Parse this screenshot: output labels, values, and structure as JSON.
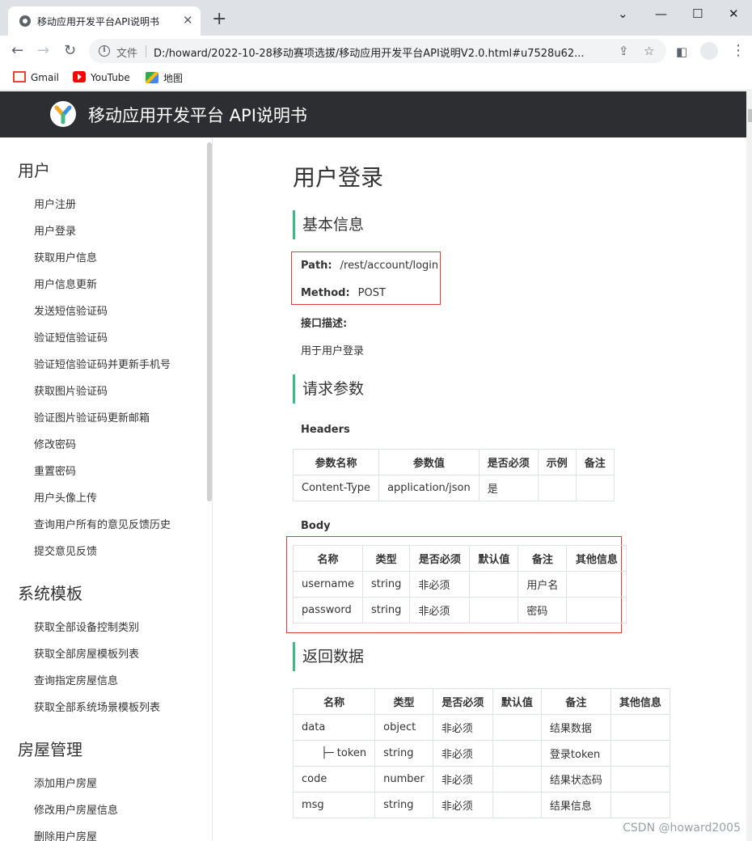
{
  "browser": {
    "tab_title": "移动应用开发平台API说明书",
    "tab_close": "✕",
    "new_tab": "+",
    "window_controls": {
      "minimize": "⌄",
      "restore": "—",
      "maximize": "☐",
      "close": "✕"
    },
    "nav": {
      "back": "←",
      "forward": "→",
      "reload": "↻"
    },
    "omnibox": {
      "label": "文件",
      "url": "D:/howard/2022-10-28移动赛项选拔/移动应用开发平台API说明V2.0.html#u7528u62..."
    },
    "bookmarks": [
      {
        "label": "Gmail",
        "icon": "gmail-icon"
      },
      {
        "label": "YouTube",
        "icon": "youtube-icon"
      },
      {
        "label": "地图",
        "icon": "maps-icon"
      }
    ]
  },
  "site": {
    "title": "移动应用开发平台 API说明书"
  },
  "sidebar": {
    "groups": [
      {
        "title": "用户",
        "items": [
          "用户注册",
          "用户登录",
          "获取用户信息",
          "用户信息更新",
          "发送短信验证码",
          "验证短信验证码",
          "验证短信验证码并更新手机号",
          "获取图片验证码",
          "验证图片验证码更新邮箱",
          "修改密码",
          "重置密码",
          "用户头像上传",
          "查询用户所有的意见反馈历史",
          "提交意见反馈"
        ]
      },
      {
        "title": "系统模板",
        "items": [
          "获取全部设备控制类别",
          "获取全部房屋模板列表",
          "查询指定房屋信息",
          "获取全部系统场景模板列表"
        ]
      },
      {
        "title": "房屋管理",
        "items": [
          "添加用户房屋",
          "修改用户房屋信息",
          "删除用户房屋"
        ]
      }
    ]
  },
  "main": {
    "title": "用户登录",
    "basic": {
      "heading": "基本信息",
      "path_label": "Path:",
      "path": "/rest/account/login",
      "method_label": "Method:",
      "method": "POST",
      "desc_label": "接口描述:",
      "desc": "用于用户登录"
    },
    "request": {
      "heading": "请求参数",
      "headers_label": "Headers",
      "headers_table": {
        "columns": [
          "参数名称",
          "参数值",
          "是否必须",
          "示例",
          "备注"
        ],
        "rows": [
          [
            "Content-Type",
            "application/json",
            "是",
            "",
            ""
          ]
        ]
      },
      "body_label": "Body",
      "body_table": {
        "columns": [
          "名称",
          "类型",
          "是否必须",
          "默认值",
          "备注",
          "其他信息"
        ],
        "rows": [
          [
            "username",
            "string",
            "非必须",
            "",
            "用户名",
            ""
          ],
          [
            "password",
            "string",
            "非必须",
            "",
            "密码",
            ""
          ]
        ]
      }
    },
    "response": {
      "heading": "返回数据",
      "table": {
        "columns": [
          "名称",
          "类型",
          "是否必须",
          "默认值",
          "备注",
          "其他信息"
        ],
        "rows": [
          [
            "data",
            "object",
            "非必须",
            "",
            "结果数据",
            ""
          ],
          [
            "├─ token",
            "string",
            "非必须",
            "",
            "登录token",
            ""
          ],
          [
            "code",
            "number",
            "非必须",
            "",
            "结果状态码",
            ""
          ],
          [
            "msg",
            "string",
            "非必须",
            "",
            "结果信息",
            ""
          ]
        ]
      }
    }
  },
  "watermark": "CSDN @howard2005",
  "colors": {
    "header_bg": "#2c2e31",
    "accent": "#42b983",
    "highlight_box": "#e03b3b"
  }
}
